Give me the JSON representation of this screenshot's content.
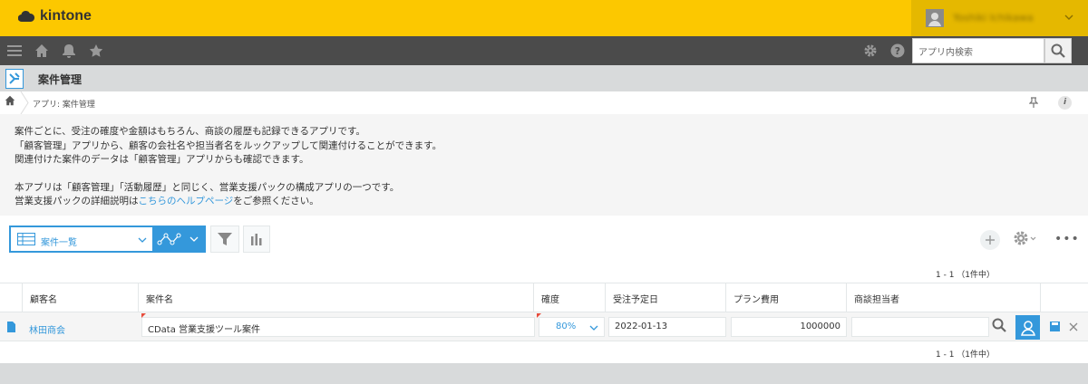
{
  "app": {
    "logo": "kintone",
    "user_name": "Yoshiki Ichikawa"
  },
  "nav": {
    "search_placeholder": "アプリ内検索"
  },
  "header": {
    "title": "案件管理"
  },
  "breadcrumb": {
    "text": "アプリ: 案件管理"
  },
  "description": {
    "line1": "案件ごとに、受注の確度や金額はもちろん、商談の履歴も記録できるアプリです。",
    "line2": "「顧客管理」アプリから、顧客の会社名や担当者名をルックアップして関連付けることができます。",
    "line3": "関連付けた案件のデータは「顧客管理」アプリからも確認できます。",
    "line4": "本アプリは「顧客管理」「活動履歴」と同じく、営業支援パックの構成アプリの一つです。",
    "line5_pre": "営業支援パックの詳細説明は",
    "line5_link": "こちらのヘルプページ",
    "line5_post": "をご参照ください。"
  },
  "toolbar": {
    "view_label": "案件一覧",
    "count_top": "1 - 1 （1件中）",
    "count_bottom": "1 - 1 （1件中）"
  },
  "table": {
    "headers": [
      "顧客名",
      "案件名",
      "確度",
      "受注予定日",
      "プラン費用",
      "商談担当者"
    ],
    "rows": [
      {
        "customer": "林田商会",
        "case": "CData 営業支援ツール案件",
        "certainty": "80%",
        "date": "2022-01-13",
        "cost": "1000000",
        "rep": ""
      }
    ]
  },
  "colors": {
    "brand": "#fcc800",
    "accent": "#3498db",
    "nav": "#4b4b4b"
  }
}
